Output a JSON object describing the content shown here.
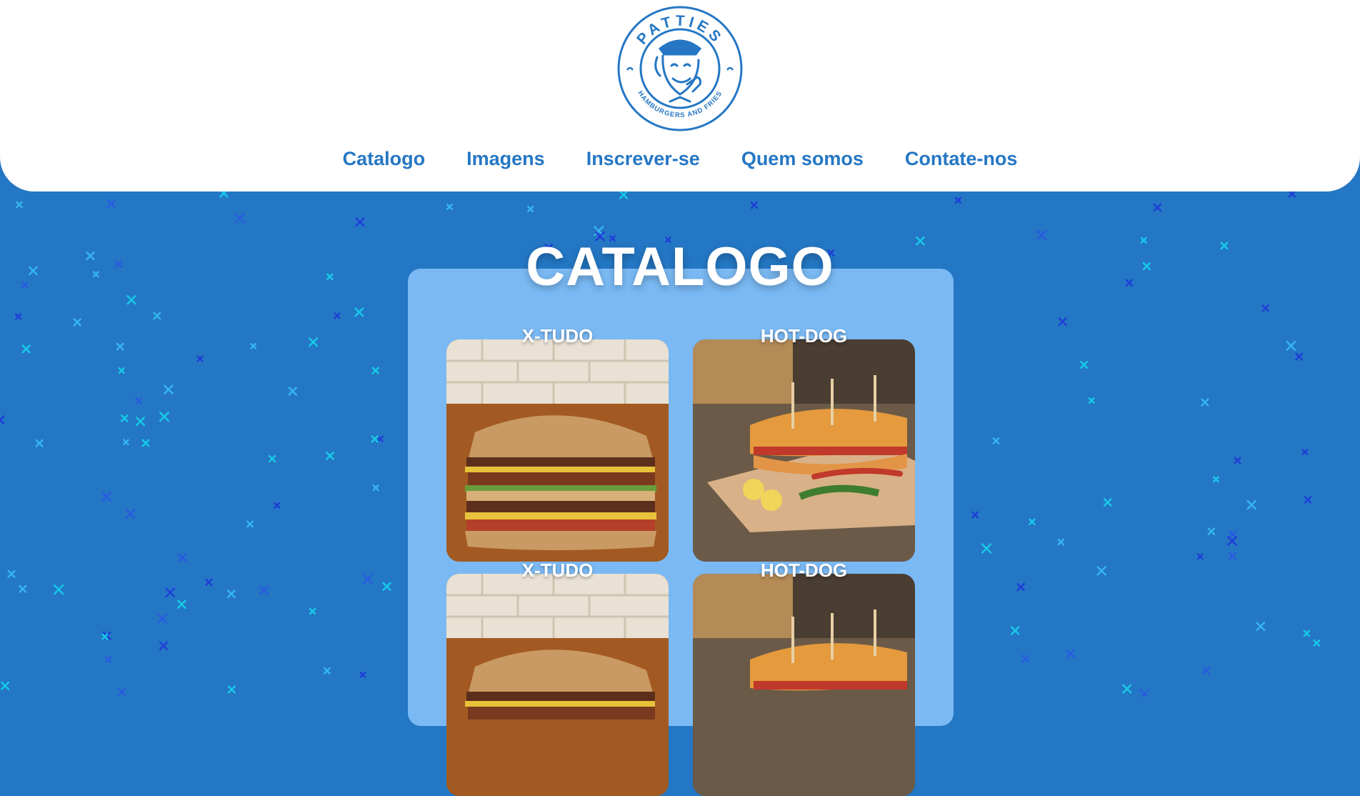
{
  "brand": {
    "name": "PATTIES",
    "tagline": "HAMBURGERS AND FRIES",
    "color": "#2577c4"
  },
  "nav": {
    "items": [
      {
        "label": "Catalogo"
      },
      {
        "label": "Imagens"
      },
      {
        "label": "Inscrever-se"
      },
      {
        "label": "Quem somos"
      },
      {
        "label": "Contate-nos"
      }
    ]
  },
  "catalog": {
    "title": "CATALOGO",
    "items": [
      {
        "name": "X-TUDO",
        "image": "sandwich-photo"
      },
      {
        "name": "HOT-DOG",
        "image": "hotdog-photo"
      },
      {
        "name": "X-TUDO",
        "image": "sandwich-photo"
      },
      {
        "name": "HOT-DOG",
        "image": "hotdog-photo"
      }
    ]
  },
  "colors": {
    "background": "#2477c4",
    "panel": "#7ab9f4",
    "header": "#ffffff"
  }
}
